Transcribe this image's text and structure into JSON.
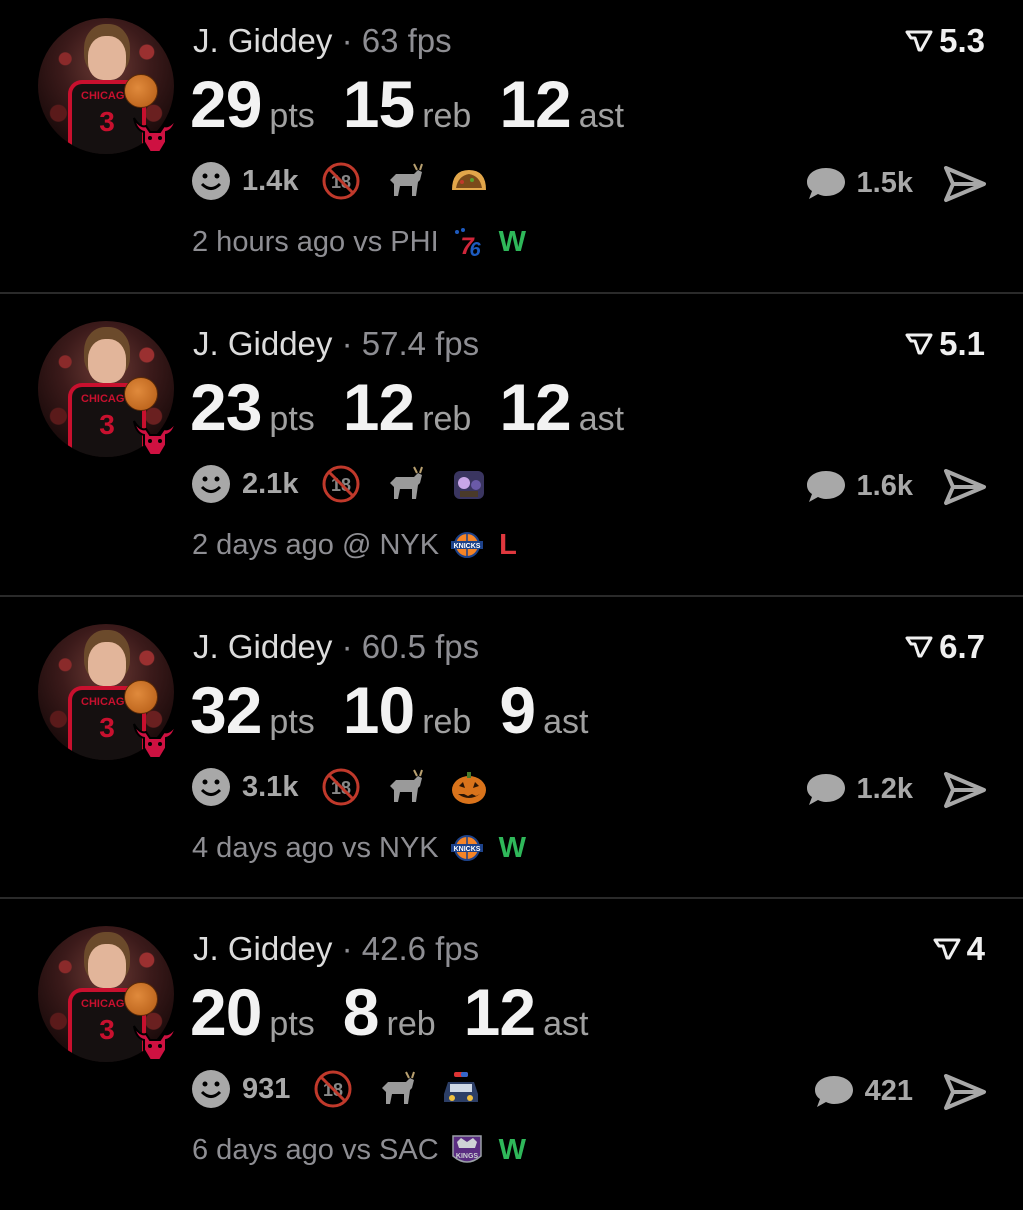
{
  "colors": {
    "background": "#000000",
    "win": "#2fb85a",
    "loss": "#e0383e",
    "muted": "#8e8e93"
  },
  "posts": [
    {
      "player": "J. Giddey",
      "fps": "· 63 fps",
      "rating": "5.3",
      "pts": "29",
      "pts_label": "pts",
      "reb": "15",
      "reb_label": "reb",
      "ast": "12",
      "ast_label": "ast",
      "reactions": "1.4k",
      "extra_icon": "taco-icon",
      "comments": "1.5k",
      "time": "2 hours ago",
      "venue": "vs PHI",
      "opponent_logo": "76ers-logo",
      "result": "W"
    },
    {
      "player": "J. Giddey",
      "fps": "· 57.4 fps",
      "rating": "5.1",
      "pts": "23",
      "pts_label": "pts",
      "reb": "12",
      "reb_label": "reb",
      "ast": "12",
      "ast_label": "ast",
      "reactions": "2.1k",
      "extra_icon": "toy-story-icon",
      "comments": "1.6k",
      "time": "2 days ago",
      "venue": "@ NYK",
      "opponent_logo": "knicks-logo",
      "result": "L"
    },
    {
      "player": "J. Giddey",
      "fps": "· 60.5 fps",
      "rating": "6.7",
      "pts": "32",
      "pts_label": "pts",
      "reb": "10",
      "reb_label": "reb",
      "ast": "9",
      "ast_label": "ast",
      "reactions": "3.1k",
      "extra_icon": "jack-o-lantern-icon",
      "comments": "1.2k",
      "time": "4 days ago",
      "venue": "vs NYK",
      "opponent_logo": "knicks-logo",
      "result": "W"
    },
    {
      "player": "J. Giddey",
      "fps": "· 42.6 fps",
      "rating": "4",
      "pts": "20",
      "pts_label": "pts",
      "reb": "8",
      "reb_label": "reb",
      "ast": "12",
      "ast_label": "ast",
      "reactions": "931",
      "extra_icon": "police-car-icon",
      "comments": "421",
      "time": "6 days ago",
      "venue": "vs SAC",
      "opponent_logo": "kings-logo",
      "result": "W"
    }
  ]
}
